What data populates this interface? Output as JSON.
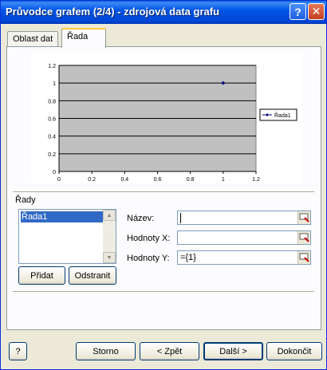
{
  "window": {
    "title": "Průvodce grafem (2/4) - zdrojová data grafu",
    "help_glyph": "?",
    "close_glyph": "✕"
  },
  "tabs": [
    {
      "label": "Oblast dat",
      "active": false
    },
    {
      "label": "Řada",
      "active": true
    }
  ],
  "chart_data": {
    "type": "scatter",
    "series": [
      {
        "name": "Řada1",
        "points": [
          {
            "x": 1,
            "y": 1
          }
        ],
        "color": "#000080"
      }
    ],
    "xlim": [
      0,
      1.2
    ],
    "ylim": [
      0,
      1.2
    ],
    "x_ticks": [
      "0",
      "0.2",
      "0.4",
      "0.6",
      "0.8",
      "1",
      "1.2"
    ],
    "y_ticks": [
      "0",
      "0.2",
      "0.4",
      "0.6",
      "0.8",
      "1",
      "1.2"
    ],
    "plot_background": "#c0c0c0",
    "grid": true,
    "legend_position": "right"
  },
  "series_panel": {
    "group_label": "Řady",
    "items": [
      "Řada1"
    ],
    "selected": "Řada1",
    "add_button": "Přidat",
    "remove_button": "Odstranit"
  },
  "fields": {
    "name_label": "Název:",
    "name_value": "",
    "x_label": "Hodnoty X:",
    "x_value": "",
    "y_label": "Hodnoty Y:",
    "y_value": "={1}"
  },
  "footer": {
    "help_glyph": "?",
    "cancel": "Storno",
    "back": "< Zpět",
    "next": "Další >",
    "finish": "Dokončit"
  }
}
